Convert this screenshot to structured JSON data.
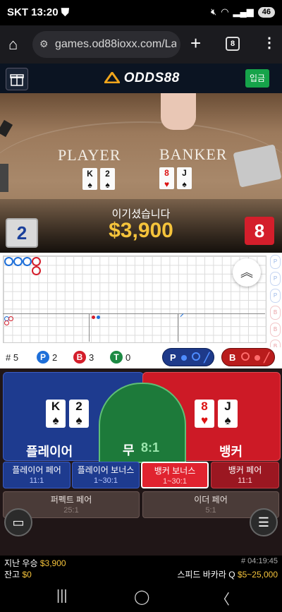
{
  "status_bar": {
    "carrier": "SKT",
    "time": "13:20",
    "battery": "46"
  },
  "browser": {
    "url": "games.od88ioxx.com/Laun",
    "tab_count": "8"
  },
  "game_header": {
    "logo": "ODDS88",
    "deposit_label": "입금"
  },
  "table": {
    "player_label": "PLAYER",
    "banker_label": "BANKER",
    "player_cards": [
      {
        "rank": "K",
        "suit": "♠"
      },
      {
        "rank": "2",
        "suit": "♠"
      }
    ],
    "banker_cards": [
      {
        "rank": "8",
        "suit": "♥"
      },
      {
        "rank": "J",
        "suit": "♠"
      }
    ],
    "player_score": "2",
    "banker_score": "8",
    "result_title": "이기셨습니다",
    "win_amount": "$3,900"
  },
  "stats": {
    "rounds_label": "# 5",
    "player_label": "P",
    "player_count": "2",
    "banker_label": "B",
    "banker_count": "3",
    "tie_label": "T",
    "tie_count": "0",
    "player_predict_label": "P",
    "banker_predict_label": "B",
    "colors": {
      "player": "#1e6fd9",
      "banker": "#d41e2b",
      "tie": "#1d8a44"
    }
  },
  "bets": {
    "player": {
      "label": "플레이어",
      "cards": [
        {
          "rank": "K",
          "suit": "♠"
        },
        {
          "rank": "2",
          "suit": "♠"
        }
      ]
    },
    "tie": {
      "label": "무",
      "odds": "8:1"
    },
    "banker": {
      "label": "뱅커",
      "cards": [
        {
          "rank": "8",
          "suit": "♥"
        },
        {
          "rank": "J",
          "suit": "♠"
        }
      ]
    },
    "side_bets": [
      {
        "label": "플레이어 페어",
        "odds": "11:1"
      },
      {
        "label": "플레이어 보너스",
        "odds": "1~30:1"
      },
      {
        "label": "뱅커 보너스",
        "odds": "1~30:1"
      },
      {
        "label": "뱅커 페어",
        "odds": "11:1"
      }
    ],
    "perfect_pair": {
      "label": "퍼펙트 페어",
      "odds": "25:1"
    },
    "either_pair": {
      "label": "이더 페어",
      "odds": "5:1"
    }
  },
  "footer": {
    "last_win_label": "지난 우승",
    "last_win_value": "$3,900",
    "balance_label": "잔고",
    "balance_value": "$0",
    "round_id": "# 04:19:45",
    "table_name": "스피드 바카라 Q",
    "limits": "$5~25,000"
  }
}
